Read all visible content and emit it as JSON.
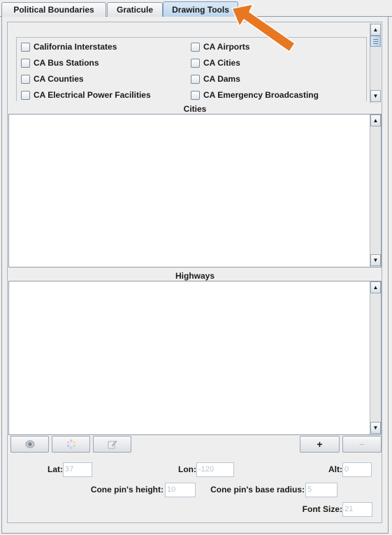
{
  "tabs": [
    {
      "label": "Political Boundaries",
      "active": false
    },
    {
      "label": "Graticule",
      "active": false
    },
    {
      "label": "Drawing Tools",
      "active": true
    }
  ],
  "layers": [
    {
      "label": "California Interstates",
      "checked": false
    },
    {
      "label": "CA Airports",
      "checked": false
    },
    {
      "label": "CA Bus Stations",
      "checked": false
    },
    {
      "label": "CA Cities",
      "checked": false
    },
    {
      "label": "CA Counties",
      "checked": false
    },
    {
      "label": "CA Dams",
      "checked": false
    },
    {
      "label": "CA Electrical Power Facilities",
      "checked": false
    },
    {
      "label": "CA Emergency Broadcasting",
      "checked": false
    }
  ],
  "sections": {
    "cities_label": "Cities",
    "highways_label": "Highways"
  },
  "toolbar": {
    "visibility_icon": "eye-icon",
    "color_icon": "color-wheel-icon",
    "edit_icon": "pencil-icon",
    "add_label": "+",
    "remove_label": "−"
  },
  "fields": {
    "lat_label": "Lat:",
    "lat_value": "37",
    "lon_label": "Lon:",
    "lon_value": "-120",
    "alt_label": "Alt:",
    "alt_value": "0",
    "cone_height_label": "Cone pin's height:",
    "cone_height_value": "10",
    "cone_radius_label": "Cone pin's base radius:",
    "cone_radius_value": "5",
    "font_size_label": "Font Size:",
    "font_size_value": "21"
  },
  "colors": {
    "accent_arrow": "#e87722",
    "active_tab": "#b9d4ee"
  }
}
